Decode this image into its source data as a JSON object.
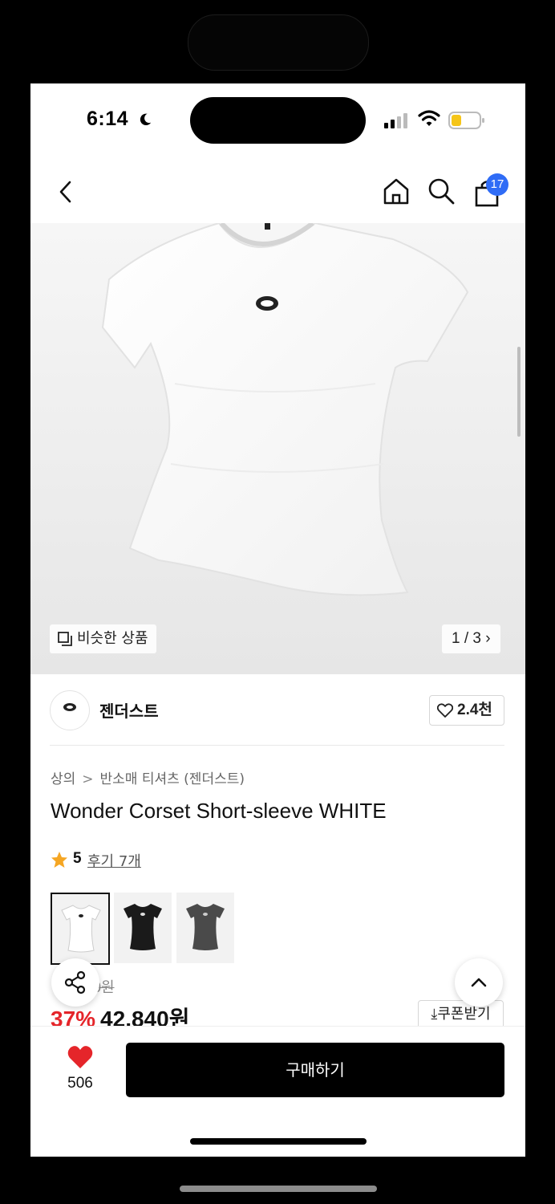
{
  "status_bar": {
    "time": "6:14"
  },
  "nav": {
    "cart_count": "17"
  },
  "gallery": {
    "similar_label": "비슷한 상품",
    "pager": "1 / 3 ›"
  },
  "brand": {
    "name": "젠더스트",
    "logo_text": "ZENDUST",
    "likes": "2.4천"
  },
  "breadcrumb": {
    "level1": "상의",
    "separator": ">",
    "level2": "반소매 티셔츠 (젠더스트)"
  },
  "product": {
    "title": "Wonder Corset Short-sleeve WHITE",
    "rating": "5",
    "reviews": "후기 7개",
    "original_price_partial": "0원",
    "discount": "37%",
    "price": "42,840원",
    "coupon_label": "⤓쿠폰받기"
  },
  "swatches": [
    {
      "color": "#ffffff",
      "name": "white"
    },
    {
      "color": "#1a1a1a",
      "name": "black"
    },
    {
      "color": "#4a4a4a",
      "name": "gray"
    }
  ],
  "bottom_bar": {
    "wish_count": "506",
    "buy_label": "구매하기"
  },
  "colors": {
    "accent_red": "#e5252a",
    "badge_blue": "#2f6cf6",
    "heart_red": "#e5252a"
  }
}
